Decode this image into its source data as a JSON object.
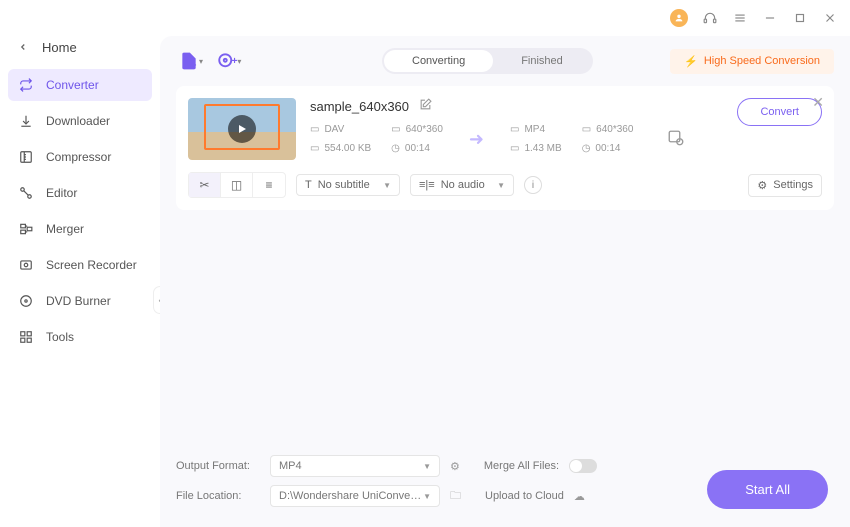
{
  "titlebar": {},
  "sidebar": {
    "home": "Home",
    "items": [
      {
        "label": "Converter"
      },
      {
        "label": "Downloader"
      },
      {
        "label": "Compressor"
      },
      {
        "label": "Editor"
      },
      {
        "label": "Merger"
      },
      {
        "label": "Screen Recorder"
      },
      {
        "label": "DVD Burner"
      },
      {
        "label": "Tools"
      }
    ]
  },
  "tabs": {
    "converting": "Converting",
    "finished": "Finished"
  },
  "hsc": "High Speed Conversion",
  "file": {
    "name": "sample_640x360",
    "src": {
      "format": "DAV",
      "res": "640*360",
      "size": "554.00 KB",
      "dur": "00:14"
    },
    "dst": {
      "format": "MP4",
      "res": "640*360",
      "size": "1.43 MB",
      "dur": "00:14"
    },
    "convert_btn": "Convert",
    "subtitle": "No subtitle",
    "audio": "No audio",
    "settings": "Settings"
  },
  "footer": {
    "output_format_label": "Output Format:",
    "output_format": "MP4",
    "file_location_label": "File Location:",
    "file_location": "D:\\Wondershare UniConverter 1",
    "merge_label": "Merge All Files:",
    "upload_label": "Upload to Cloud",
    "start_all": "Start All"
  }
}
